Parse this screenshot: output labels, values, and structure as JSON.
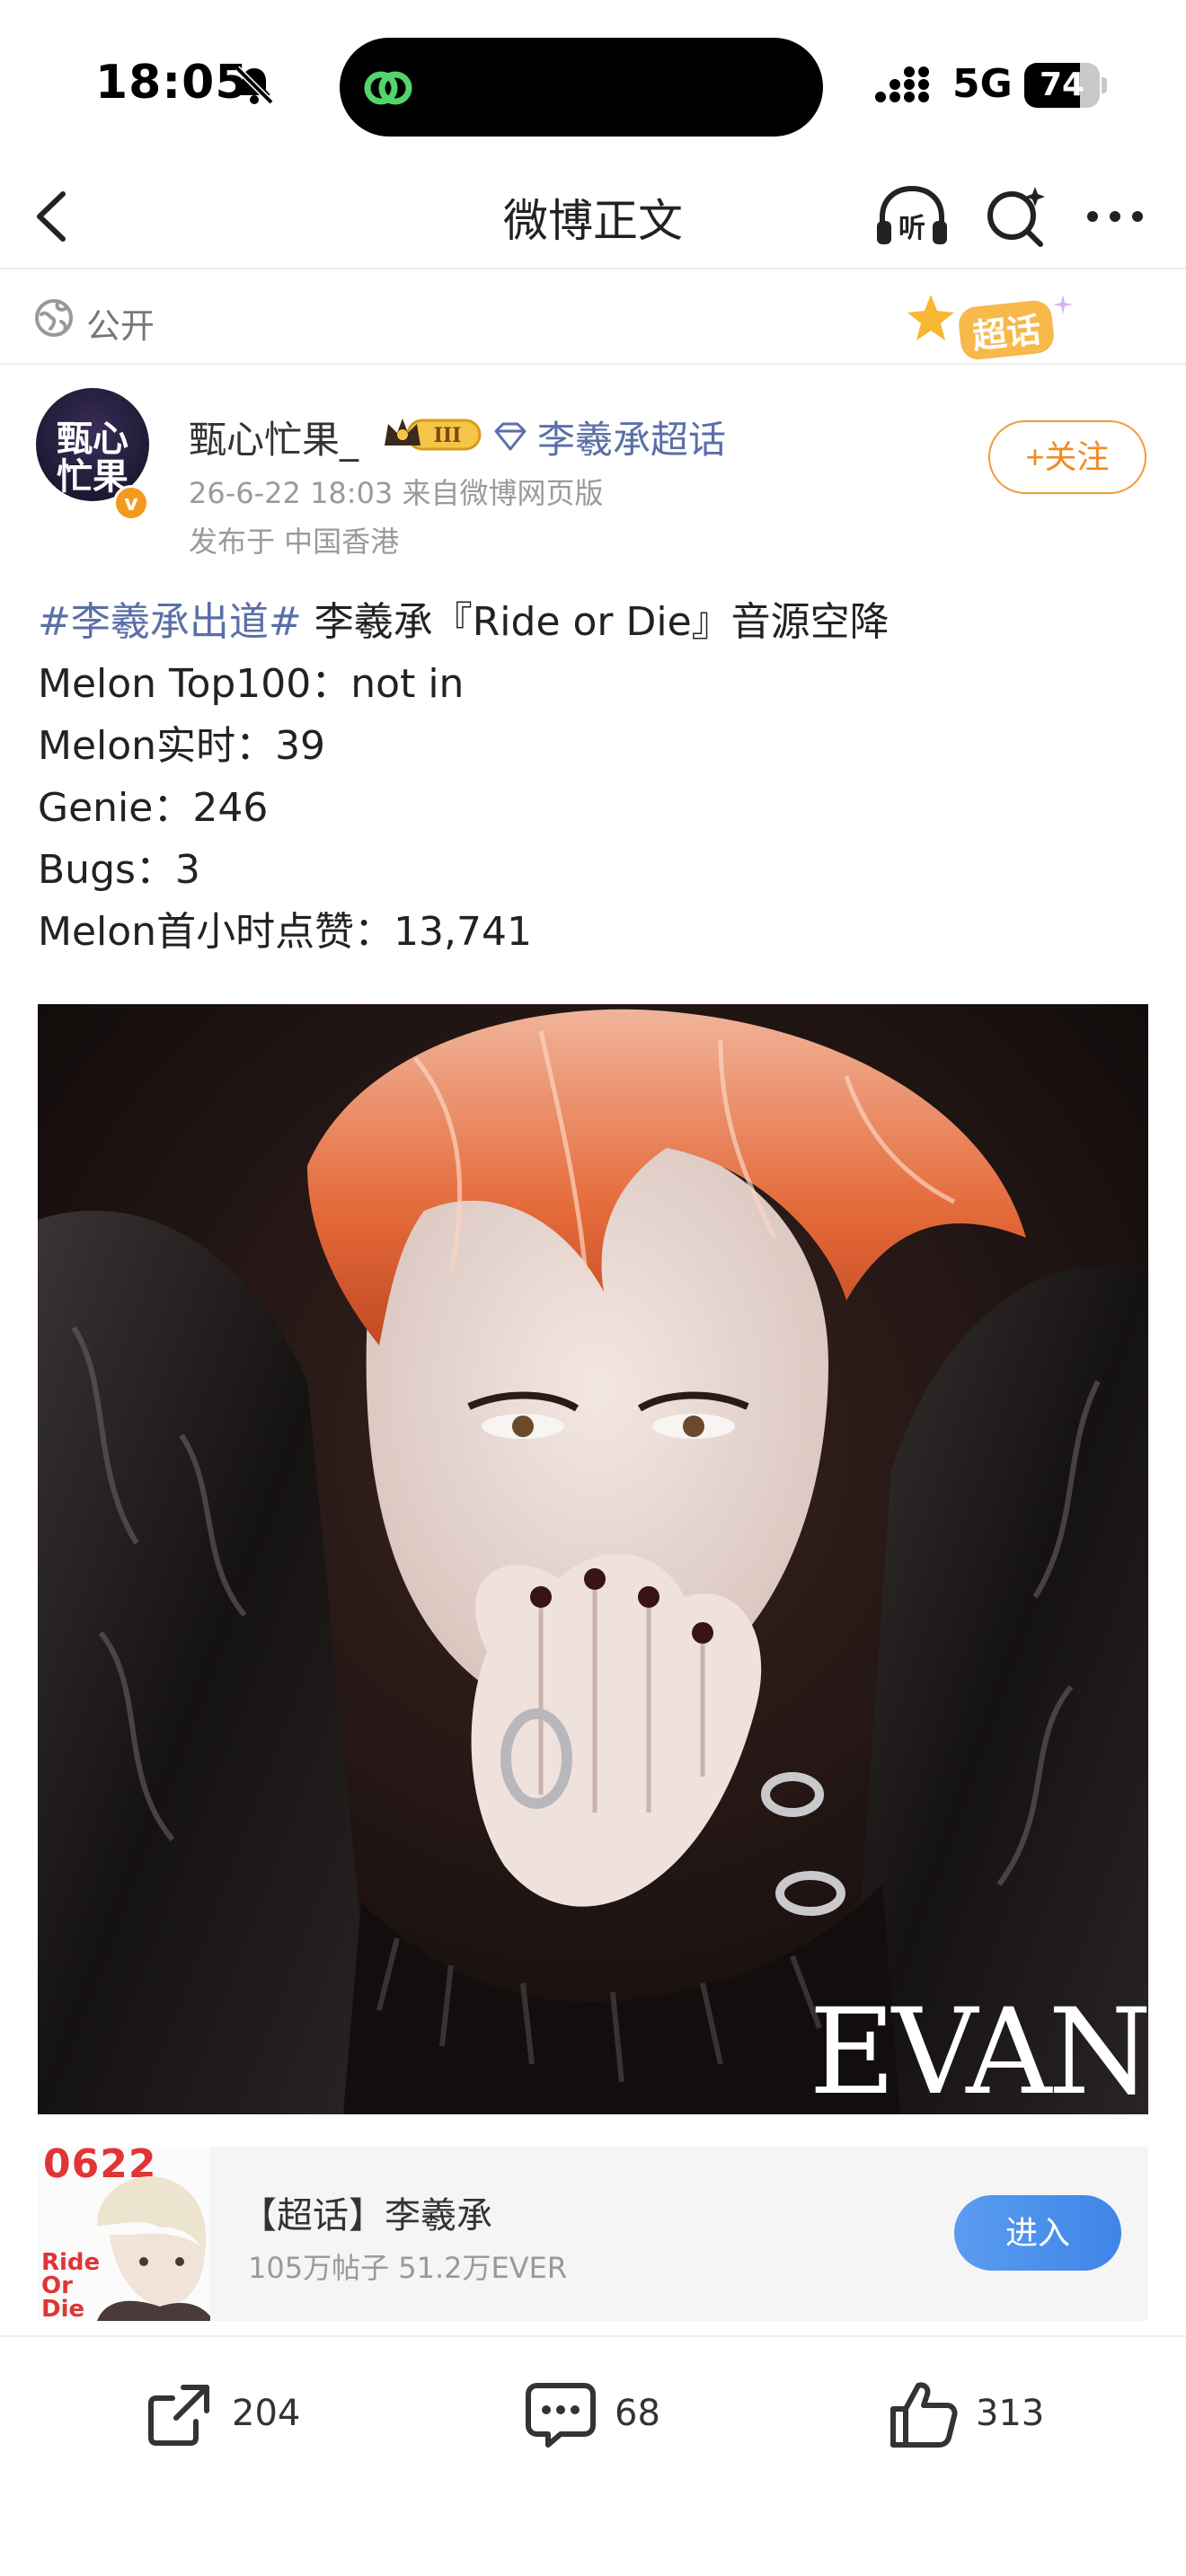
{
  "status_bar": {
    "time": "18:05",
    "network": "5G",
    "battery_level": 74
  },
  "nav": {
    "title": "微博正文"
  },
  "visibility": {
    "label": "公开",
    "sticker": "超话"
  },
  "post": {
    "author": "甄心忙果_",
    "avatar_text": "甄心忙果",
    "vip_level": "III",
    "topic_link": "李羲承超话",
    "meta": "26-6-22 18:03  来自微博网页版",
    "location": "发布于 中国香港",
    "follow_label": "+关注",
    "hashtag": "#李羲承出道#",
    "headline": " 李羲承『Ride or Die』音源空降",
    "lines": [
      "Melon Top100：not in",
      "Melon实时：39",
      "Genie：246",
      "Bugs：3",
      "Melon首小时点赞：13,741"
    ],
    "image_caption": "EVAN"
  },
  "topic_card": {
    "cover_date": "0622",
    "cover_text": "Ride Or Die",
    "title": "【超话】李羲承",
    "stats": "105万帖子 51.2万EVER",
    "enter_label": "进入"
  },
  "actions": {
    "share_count": "204",
    "comment_count": "68",
    "like_count": "313"
  },
  "colors": {
    "accent_orange": "#f18a22",
    "link_blue": "#5a6fa8",
    "button_blue": "#4a8ee9"
  }
}
